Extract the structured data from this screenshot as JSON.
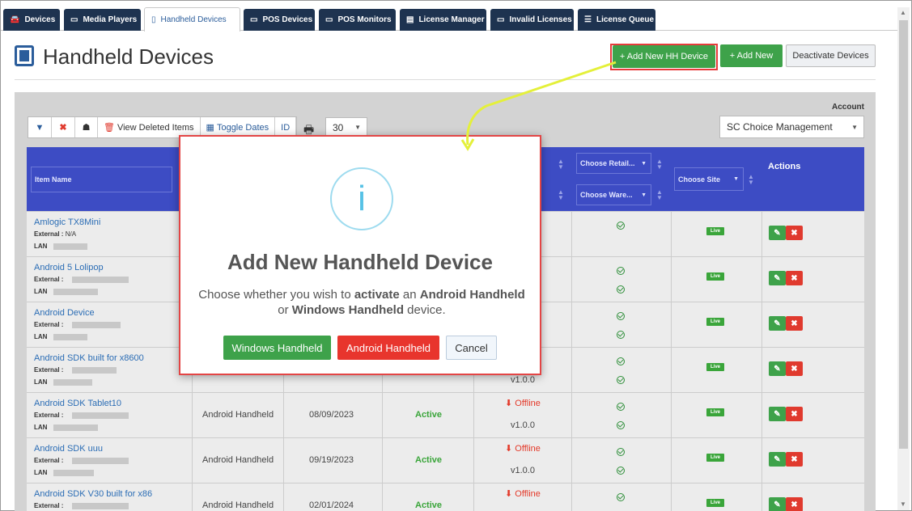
{
  "tabs": [
    {
      "label": "Devices",
      "icon": "car-icon"
    },
    {
      "label": "Media Players",
      "icon": "monitor-icon"
    },
    {
      "label": "Handheld Devices",
      "icon": "tablet-icon",
      "active": true
    },
    {
      "label": "POS Devices",
      "icon": "monitor-icon"
    },
    {
      "label": "POS Monitors",
      "icon": "monitor-icon"
    },
    {
      "label": "License Manager",
      "icon": "id-card-icon"
    },
    {
      "label": "Invalid Licenses",
      "icon": "monitor-icon"
    },
    {
      "label": "License Queue",
      "icon": "list-icon"
    }
  ],
  "page": {
    "title": "Handheld Devices"
  },
  "actions": {
    "add_hh": "+ Add New HH Device",
    "add_new": "+ Add New",
    "deactivate": "Deactivate Devices"
  },
  "toolbar": {
    "view_deleted": "View Deleted Items",
    "toggle_dates": "Toggle Dates",
    "id": "ID",
    "page_size": "30"
  },
  "account": {
    "label": "Account",
    "value": "SC Choice Management"
  },
  "table": {
    "headers": {
      "item_name": "Item Name",
      "retailer_placeholder": "Choose Retail...",
      "warehouse_placeholder": "Choose Ware...",
      "site_placeholder": "Choose Site",
      "actions": "Actions"
    },
    "rows": [
      {
        "name": "Amlogic TX8Mini",
        "external_label": "External :",
        "external_value": "N/A",
        "lan_label": "LAN",
        "type": "",
        "date": "",
        "status": "",
        "online": "",
        "version": "",
        "site_status": "Live"
      },
      {
        "name": "Android 5 Lolipop",
        "external_label": "External :",
        "external_value": "",
        "lan_label": "LAN",
        "type": "",
        "date": "",
        "status": "",
        "online": "",
        "version": "",
        "site_status": "Live"
      },
      {
        "name": "Android Device",
        "external_label": "External :",
        "external_value": "",
        "lan_label": "LAN",
        "type": "",
        "date": "",
        "status": "",
        "online": "",
        "version": "",
        "site_status": "Live"
      },
      {
        "name": "Android SDK built for x8600",
        "external_label": "External :",
        "external_value": "",
        "lan_label": "LAN",
        "type": "",
        "date": "",
        "status": "",
        "online": "",
        "version": "v1.0.0",
        "site_status": "Live"
      },
      {
        "name": "Android SDK Tablet10",
        "external_label": "External :",
        "external_value": "",
        "lan_label": "LAN",
        "type": "Android Handheld",
        "date": "08/09/2023",
        "status": "Active",
        "online": "Offline",
        "version": "v1.0.0",
        "site_status": "Live"
      },
      {
        "name": "Android SDK uuu",
        "external_label": "External :",
        "external_value": "",
        "lan_label": "LAN",
        "type": "Android Handheld",
        "date": "09/19/2023",
        "status": "Active",
        "online": "Offline",
        "version": "v1.0.0",
        "site_status": "Live"
      },
      {
        "name": "Android SDK V30 built for x86",
        "external_label": "External :",
        "external_value": "",
        "lan_label": "",
        "type": "Android Handheld",
        "date": "02/01/2024",
        "status": "Active",
        "online": "Offline",
        "version": "",
        "site_status": "Live"
      }
    ]
  },
  "modal": {
    "title": "Add New Handheld Device",
    "msg_1": "Choose whether you wish to ",
    "msg_activate": "activate",
    "msg_2": " an ",
    "msg_android": "Android Handheld",
    "msg_3": " or ",
    "msg_windows": "Windows Handheld",
    "msg_4": " device.",
    "windows_button": "Windows Handheld",
    "android_button": "Android Handheld",
    "cancel_button": "Cancel",
    "info_glyph": "i"
  },
  "colors": {
    "tab_bg": "#1e3350",
    "header_bg": "#3d4cc4",
    "green": "#3ea24a",
    "red": "#e8352d",
    "highlight": "#e34545",
    "annotation_arrow": "#e4f03a"
  }
}
